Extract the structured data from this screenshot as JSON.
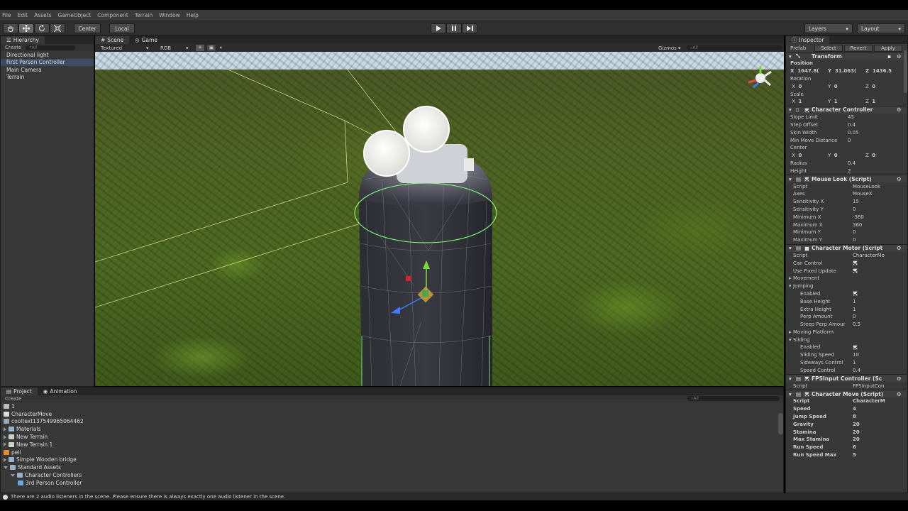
{
  "menu": [
    "File",
    "Edit",
    "Assets",
    "GameObject",
    "Component",
    "Terrain",
    "Window",
    "Help"
  ],
  "toolbar": {
    "pivot_center": "Center",
    "pivot_local": "Local",
    "layers": "Layers",
    "layout": "Layout"
  },
  "hierarchy": {
    "tab": "Hierarchy",
    "create": "Create",
    "search": "All",
    "items": [
      "Directional light",
      "First Person Controller",
      "Main Camera",
      "Terrain"
    ],
    "selected_index": 1
  },
  "scene": {
    "tab_scene": "Scene",
    "tab_game": "Game",
    "render_mode": "Textured",
    "color_mode": "RGB",
    "gizmos": "Gizmos",
    "search": "All"
  },
  "project": {
    "tab_project": "Project",
    "tab_animation": "Animation",
    "create": "Create",
    "search": "All",
    "items": [
      {
        "label": "1",
        "indent": 0,
        "icon": "scene"
      },
      {
        "label": "CharacterMove",
        "indent": 0,
        "icon": "script"
      },
      {
        "label": "cooltext137549965064462",
        "indent": 0,
        "icon": "image"
      },
      {
        "label": "Materials",
        "indent": 0,
        "icon": "folder"
      },
      {
        "label": "New Terrain",
        "indent": 0,
        "icon": "terrain"
      },
      {
        "label": "New Terrain 1",
        "indent": 0,
        "icon": "terrain"
      },
      {
        "label": "pell",
        "indent": 0,
        "icon": "material"
      },
      {
        "label": "Simple Wooden bridge",
        "indent": 0,
        "icon": "folder"
      },
      {
        "label": "Standard Assets",
        "indent": 0,
        "icon": "folder"
      },
      {
        "label": "Character Controllers",
        "indent": 1,
        "icon": "folder"
      },
      {
        "label": "3rd Person Controller",
        "indent": 2,
        "icon": "prefab"
      }
    ]
  },
  "status": {
    "message": "There are 2 audio listeners in the scene. Please ensure there is always exactly one audio listener in the scene."
  },
  "inspector": {
    "tab": "Inspector",
    "prefab": "Prefab",
    "select": "Select",
    "revert": "Revert",
    "apply": "Apply",
    "transform": {
      "title": "Transform",
      "position": "Position",
      "pos_x": "1647.8(",
      "pos_y": "31.063(",
      "pos_z": "1436.5",
      "rotation": "Rotation",
      "rot_x": "0",
      "rot_y": "0",
      "rot_z": "0",
      "scale": "Scale",
      "scale_x": "1",
      "scale_y": "1",
      "scale_z": "1"
    },
    "character_controller": {
      "title": "Character Controller",
      "slope_limit_label": "Slope Limit",
      "slope_limit": "45",
      "step_offset_label": "Step Offset",
      "step_offset": "0.4",
      "skin_width_label": "Skin Width",
      "skin_width": "0.05",
      "min_move_label": "Min Move Distance",
      "min_move": "0",
      "center_label": "Center",
      "center_x": "0",
      "center_y": "0",
      "center_z": "0",
      "radius_label": "Radius",
      "radius": "0.4",
      "height_label": "Height",
      "height": "2"
    },
    "mouse_look": {
      "title": "Mouse Look (Script)",
      "rows": [
        {
          "label": "Script",
          "value": "MouseLook"
        },
        {
          "label": "Axes",
          "value": "MouseX"
        },
        {
          "label": "Sensitivity X",
          "value": "15"
        },
        {
          "label": "Sensitivity Y",
          "value": "0"
        },
        {
          "label": "Minimum X",
          "value": "-360"
        },
        {
          "label": "Maximum X",
          "value": "360"
        },
        {
          "label": "Minimum Y",
          "value": "0"
        },
        {
          "label": "Maximum Y",
          "value": "0"
        }
      ]
    },
    "character_motor": {
      "title": "Character Motor (Script",
      "script_label": "Script",
      "script": "CharacterMo",
      "can_control_label": "Can Control",
      "use_fixed_update_label": "Use Fixed Update",
      "movement_label": "Movement",
      "jumping_label": "Jumping",
      "jump_rows": [
        {
          "label": "Enabled",
          "value": "",
          "check": true
        },
        {
          "label": "Base Height",
          "value": "1"
        },
        {
          "label": "Extra Height",
          "value": "1"
        },
        {
          "label": "Perp Amount",
          "value": "0"
        },
        {
          "label": "Steep Perp Amour",
          "value": "0.5"
        }
      ],
      "moving_platform_label": "Moving Platform",
      "sliding_label": "Sliding",
      "slide_rows": [
        {
          "label": "Enabled",
          "value": "",
          "check": true
        },
        {
          "label": "Sliding Speed",
          "value": "10"
        },
        {
          "label": "Sideways Control",
          "value": "1"
        },
        {
          "label": "Speed Control",
          "value": "0.4"
        }
      ]
    },
    "fps_input": {
      "title": "FPSInput Controller (Sc",
      "script_label": "Script",
      "script": "FPSInputCon"
    },
    "character_move": {
      "title": "Character Move (Script)",
      "rows": [
        {
          "label": "Script",
          "value": "CharacterM"
        },
        {
          "label": "Speed",
          "value": "4"
        },
        {
          "label": "Jump Speed",
          "value": "8"
        },
        {
          "label": "Gravity",
          "value": "20"
        },
        {
          "label": "Stamina",
          "value": "20"
        },
        {
          "label": "Max Stamina",
          "value": "20"
        },
        {
          "label": "Run Speed",
          "value": "6"
        },
        {
          "label": "Run Speed Max",
          "value": "5"
        }
      ]
    }
  }
}
